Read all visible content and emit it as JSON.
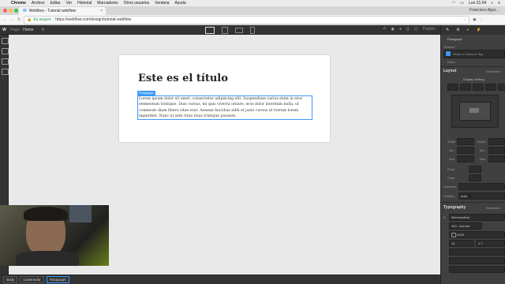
{
  "menubar": {
    "app": "Chrome",
    "items": [
      "Archivo",
      "Editar",
      "Ver",
      "Historial",
      "Marcadores",
      "Otros usuarios",
      "Ventana",
      "Ayuda"
    ],
    "clock": "Lun 21:04"
  },
  "browser": {
    "tab_title": "Webflow - Tutorial webflow",
    "user": "Francisco Agui...",
    "secure_label": "Es seguro",
    "url": "https://webflow.com/design/tutorial-webflow"
  },
  "webflow_top": {
    "page_label": "Page:",
    "page_name": "Home",
    "publish_label": "Publish"
  },
  "canvas": {
    "title": "Este es el título",
    "paragraph_tag": "Paragraph",
    "paragraph": "Lorem ipsum dolor sit amet, consectetur adipiscing elit. Suspendisse varius enim in eros elementum tristique. Duis cursus, mi quis viverra ornare, eros dolor interdum nulla, ut commodo diam libero vitae erat. Aenean faucibus nibh et justo cursus id rutrum lorem imperdiet. Nunc ut sem vitae risus tristique posuere."
  },
  "right_panel": {
    "element": "Paragraph",
    "selector_label": "Selector",
    "selector_placeholder": "Select a Class or Tag",
    "none_label": "None",
    "layout_title": "Layout",
    "advanced": "Advanced",
    "display_label": "Display Setting",
    "width": "Width",
    "height": "Height",
    "min": "Min",
    "max": "Max",
    "float": "Float",
    "clear": "Clear",
    "overflow": "Overflow",
    "position": "Position",
    "position_value": "Auto",
    "typography_title": "Typography",
    "font": "Merriweather",
    "weight": "400 - Normal",
    "color": "#333",
    "size": "14",
    "line_height": "1.7"
  },
  "breadcrumbs": [
    "Body",
    "contenedor",
    "Paragraph"
  ],
  "colors": {
    "accent": "#3b99fc",
    "panel_bg": "#404040",
    "canvas_bg": "#e9e9e9"
  }
}
